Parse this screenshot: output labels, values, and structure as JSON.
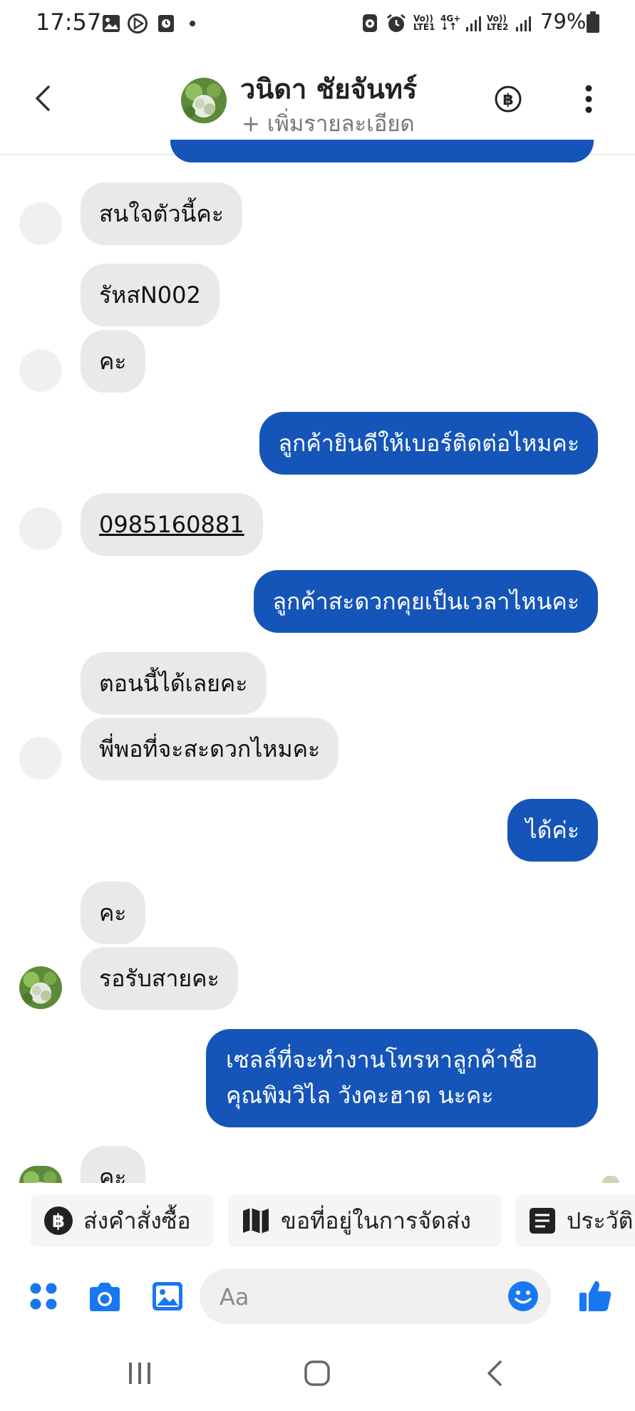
{
  "status_bar": {
    "time": "17:57",
    "battery_percent": "79%",
    "sim1_label_top": "Vo))",
    "sim1_label_bottom": "LTE1",
    "net_label_top": "4G+",
    "sim2_label_top": "Vo))",
    "sim2_label_bottom": "LTE2",
    "icons": [
      "gallery-icon",
      "media-icon",
      "clock-app-icon",
      "dot-icon",
      "alarm-lock-icon",
      "alarm-icon",
      "signal-icon",
      "battery-icon"
    ]
  },
  "header": {
    "contact_name": "วนิดา ชัยจันทร์",
    "add_details": "+ เพิ่มรายละเอียด",
    "icons": [
      "back-icon",
      "baht-icon",
      "more-vertical-icon"
    ]
  },
  "messages": [
    {
      "side": "in",
      "text": "สนใจตัวนี้คะ"
    },
    {
      "side": "in",
      "text": "รัหสN002"
    },
    {
      "side": "in",
      "text": "คะ"
    },
    {
      "side": "out",
      "text": "ลูกค้ายินดีให้เบอร์ติดต่อไหมคะ"
    },
    {
      "side": "in",
      "text": "0985160881"
    },
    {
      "side": "out",
      "text": "ลูกค้าสะดวกคุยเป็นเวลาไหนคะ"
    },
    {
      "side": "in",
      "text": "ตอนนี้ได้เลยคะ"
    },
    {
      "side": "in",
      "text": "พี่พอที่จะสะดวกไหมคะ"
    },
    {
      "side": "out",
      "text": "ได้ค่ะ"
    },
    {
      "side": "in",
      "text": "คะ"
    },
    {
      "side": "in",
      "text": "รอรับสายคะ"
    },
    {
      "side": "out",
      "text": "เซลล์ที่จะทำงานโทรหาลูกค้าชื่อ คุณพิมวิไล วังคะฮาต นะคะ"
    },
    {
      "side": "in",
      "text": "คะ"
    }
  ],
  "quick_actions": [
    {
      "label": "ส่งคำสั่งซื้อ",
      "icon": "baht-icon"
    },
    {
      "label": "ขอที่อยู่ในการจัดส่ง",
      "icon": "map-icon"
    },
    {
      "label": "ประวัติ",
      "icon": "document-icon"
    }
  ],
  "composer": {
    "placeholder": "Aa",
    "icons": [
      "apps-icon",
      "camera-icon",
      "image-icon",
      "emoji-icon",
      "like-icon"
    ]
  },
  "colors": {
    "outgoing_bubble": "#1555b9",
    "incoming_bubble": "#e9e9e9",
    "accent": "#1877f2"
  }
}
